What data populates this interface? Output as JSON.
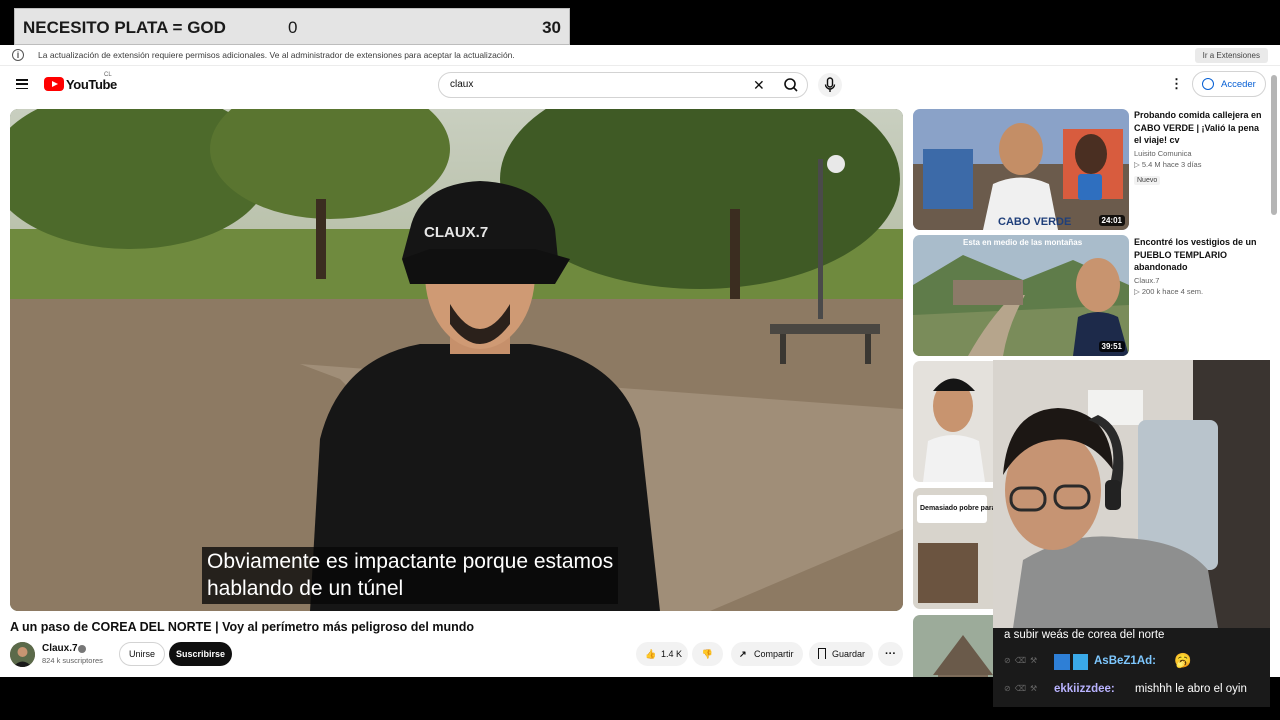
{
  "overlay": {
    "counter_label": "NECESITO PLATA = GOD",
    "counter_value_1": "0",
    "counter_value_2": "30"
  },
  "infobar": {
    "message": "La actualización de extensión requiere permisos adicionales. Ve al administrador de extensiones para aceptar la actualización.",
    "button": "Ir a Extensiones"
  },
  "header": {
    "logo_text": "YouTube",
    "country": "CL",
    "search_query": "claux",
    "signin_label": "Acceder"
  },
  "video": {
    "subtitle_line1": "Obviamente es impactante porque estamos",
    "subtitle_line2": "hablando de un túnel",
    "title": "A un paso de COREA DEL NORTE | Voy al perímetro más peligroso del mundo",
    "channel": "Claux.7",
    "subscribers": "824 k suscriptores",
    "join_label": "Unirse",
    "subscribe_label": "Suscribirse",
    "likes": "1.4 K",
    "share_label": "Compartir",
    "save_label": "Guardar"
  },
  "recommendations": [
    {
      "title": "Probando comida callejera en CABO VERDE | ¡Valió la pena el viaje! cv",
      "channel": "Luisito Comunica",
      "stats": "▷ 5.4 M  hace 3 días",
      "badge": "Nuevo",
      "duration": "24:01",
      "thumb_text": "CABO VERDE"
    },
    {
      "title": "Encontré los vestigios de un PUEBLO TEMPLARIO abandonado",
      "channel": "Claux.7",
      "stats": "▷ 200 k  hace 4 sem.",
      "duration": "39:51",
      "thumb_text": "Esta en medio de las montañas"
    },
    {
      "thumb_text": ""
    },
    {
      "thumb_text": "Demasiado pobre para la residencia"
    }
  ],
  "chat": {
    "line1": "a subir weás de corea del norte",
    "user1": "AsBeZ1Ad:",
    "user2": "ekkiizzdee:",
    "msg2": "mishhh le abro el oyin"
  },
  "icons": {
    "menu": "hamburger-icon",
    "search": "search-icon",
    "mic": "microphone-icon",
    "clear": "close-icon",
    "like": "thumbs-up-icon",
    "dislike": "thumbs-down-icon",
    "share": "share-icon",
    "save": "bookmark-icon",
    "more": "more-horizontal-icon"
  }
}
